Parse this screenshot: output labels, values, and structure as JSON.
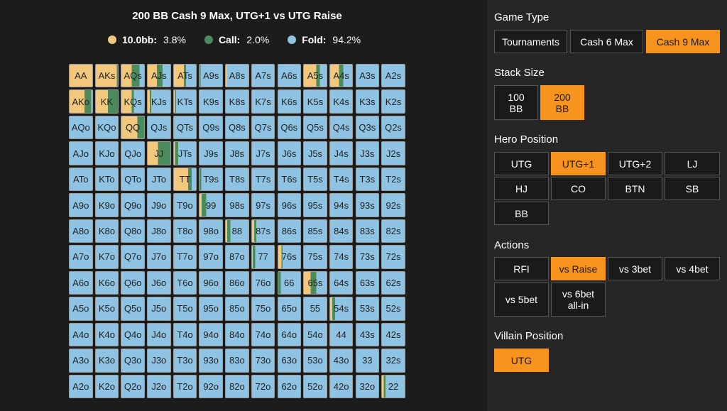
{
  "chart": {
    "title": "200 BB Cash 9 Max, UTG+1 vs UTG Raise",
    "legend": [
      {
        "name": "10.0bb:",
        "pct": "3.8%",
        "color": "#f3c77c"
      },
      {
        "name": "Call:",
        "pct": "2.0%",
        "color": "#4a8c5c"
      },
      {
        "name": "Fold:",
        "pct": "94.2%",
        "color": "#8ec3e3"
      }
    ]
  },
  "chart_data": {
    "type": "heatmap",
    "action_colors": {
      "raise": "#f3c77c",
      "call": "#4a8c5c",
      "fold": "#8ec3e3"
    },
    "rows": [
      [
        "AA",
        "AKs",
        "AQs",
        "AJs",
        "ATs",
        "A9s",
        "A8s",
        "A7s",
        "A6s",
        "A5s",
        "A4s",
        "A3s",
        "A2s"
      ],
      [
        "AKo",
        "KK",
        "KQs",
        "KJs",
        "KTs",
        "K9s",
        "K8s",
        "K7s",
        "K6s",
        "K5s",
        "K4s",
        "K3s",
        "K2s"
      ],
      [
        "AQo",
        "KQo",
        "QQ",
        "QJs",
        "QTs",
        "Q9s",
        "Q8s",
        "Q7s",
        "Q6s",
        "Q5s",
        "Q4s",
        "Q3s",
        "Q2s"
      ],
      [
        "AJo",
        "KJo",
        "QJo",
        "JJ",
        "JTs",
        "J9s",
        "J8s",
        "J7s",
        "J6s",
        "J5s",
        "J4s",
        "J3s",
        "J2s"
      ],
      [
        "ATo",
        "KTo",
        "QTo",
        "JTo",
        "TT",
        "T9s",
        "T8s",
        "T7s",
        "T6s",
        "T5s",
        "T4s",
        "T3s",
        "T2s"
      ],
      [
        "A9o",
        "K9o",
        "Q9o",
        "J9o",
        "T9o",
        "99",
        "98s",
        "97s",
        "96s",
        "95s",
        "94s",
        "93s",
        "92s"
      ],
      [
        "A8o",
        "K8o",
        "Q8o",
        "J8o",
        "T8o",
        "98o",
        "88",
        "87s",
        "86s",
        "85s",
        "84s",
        "83s",
        "82s"
      ],
      [
        "A7o",
        "K7o",
        "Q7o",
        "J7o",
        "T7o",
        "97o",
        "87o",
        "77",
        "76s",
        "75s",
        "74s",
        "73s",
        "72s"
      ],
      [
        "A6o",
        "K6o",
        "Q6o",
        "J6o",
        "T6o",
        "96o",
        "86o",
        "76o",
        "66",
        "65s",
        "64s",
        "63s",
        "62s"
      ],
      [
        "A5o",
        "K5o",
        "Q5o",
        "J5o",
        "T5o",
        "95o",
        "85o",
        "75o",
        "65o",
        "55",
        "54s",
        "53s",
        "52s"
      ],
      [
        "A4o",
        "K4o",
        "Q4o",
        "J4o",
        "T4o",
        "94o",
        "84o",
        "74o",
        "64o",
        "54o",
        "44",
        "43s",
        "42s"
      ],
      [
        "A3o",
        "K3o",
        "Q3o",
        "J3o",
        "T3o",
        "93o",
        "83o",
        "73o",
        "63o",
        "53o",
        "43o",
        "33",
        "32s"
      ],
      [
        "A2o",
        "K2o",
        "Q2o",
        "J2o",
        "T2o",
        "92o",
        "82o",
        "72o",
        "62o",
        "52o",
        "42o",
        "32o",
        "22"
      ]
    ],
    "frequencies": {
      "AA": [
        1.0,
        0.0
      ],
      "AKs": [
        0.95,
        0.05
      ],
      "AQs": [
        0.45,
        0.35
      ],
      "AJs": [
        0.4,
        0.25
      ],
      "ATs": [
        0.45,
        0.1
      ],
      "A9s": [
        0.0,
        0.04
      ],
      "A8s": [
        0.05,
        0.0
      ],
      "A5s": [
        0.55,
        0.15
      ],
      "A4s": [
        0.4,
        0.2
      ],
      "AKo": [
        0.65,
        0.3
      ],
      "KK": [
        0.55,
        0.45
      ],
      "KQs": [
        0.45,
        0.1
      ],
      "KJs": [
        0.1,
        0.05
      ],
      "KTs": [
        0.05,
        0.05
      ],
      "QQ": [
        0.7,
        0.3
      ],
      "JJ": [
        0.45,
        0.55
      ],
      "JTs": [
        0.05,
        0.15
      ],
      "TT": [
        0.65,
        0.15
      ],
      "T9s": [
        0.0,
        0.08
      ],
      "99": [
        0.1,
        0.2
      ],
      "88": [
        0.06,
        0.14
      ],
      "87s": [
        0.1,
        0.1
      ],
      "77": [
        0.04,
        0.1
      ],
      "76s": [
        0.15,
        0.05
      ],
      "66": [
        0.0,
        0.12
      ],
      "65s": [
        0.3,
        0.25
      ],
      "54s": [
        0.1,
        0.12
      ],
      "22": [
        0.08,
        0.08
      ]
    }
  },
  "panel": {
    "game_type": {
      "title": "Game Type",
      "options": [
        "Tournaments",
        "Cash 6 Max",
        "Cash 9 Max"
      ],
      "active": 2
    },
    "stack_size": {
      "title": "Stack Size",
      "options": [
        "100\nBB",
        "200\nBB"
      ],
      "active": 1
    },
    "hero_position": {
      "title": "Hero Position",
      "options": [
        "UTG",
        "UTG+1",
        "UTG+2",
        "LJ",
        "HJ",
        "CO",
        "BTN",
        "SB",
        "BB"
      ],
      "active": 1
    },
    "actions": {
      "title": "Actions",
      "options": [
        "RFI",
        "vs Raise",
        "vs 3bet",
        "vs 4bet",
        "vs 5bet",
        "vs 6bet\nall-in"
      ],
      "active": 1
    },
    "villain_position": {
      "title": "Villain Position",
      "options": [
        "UTG"
      ],
      "active": 0
    }
  }
}
